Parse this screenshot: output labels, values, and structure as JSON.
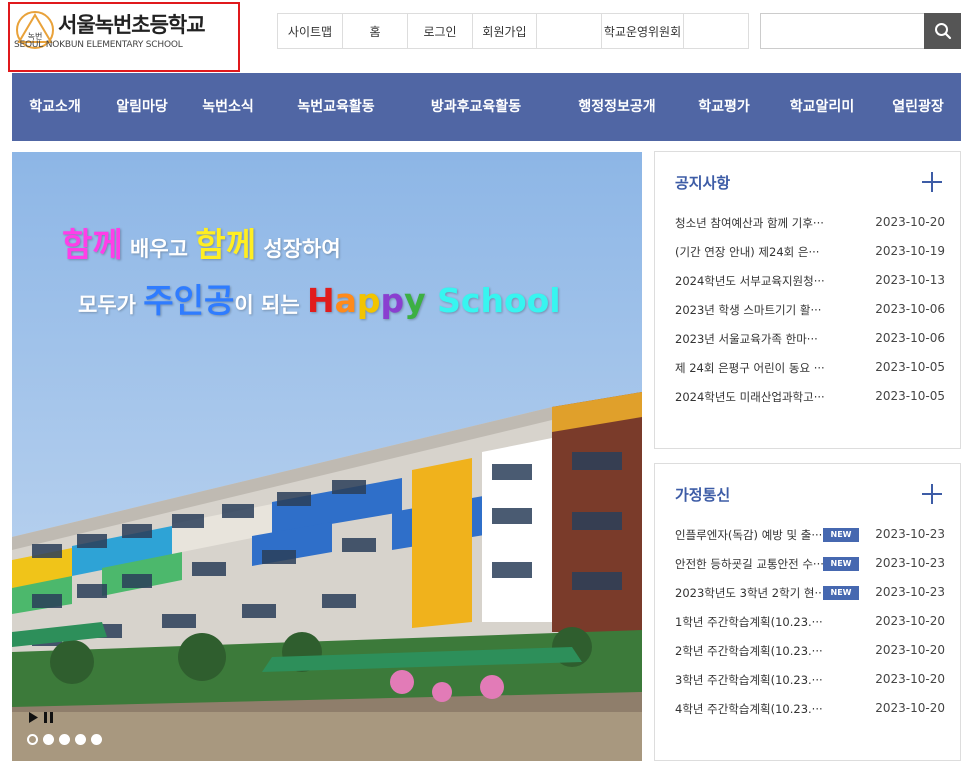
{
  "logo": {
    "name": "서울녹번초등학교",
    "emblem_text": "녹번",
    "english": "SEOUL NOKBUN ELEMENTARY SCHOOL"
  },
  "util_nav": [
    {
      "label": "사이트맵"
    },
    {
      "label": "홈"
    },
    {
      "label": "로그인"
    },
    {
      "label": "회원가입"
    },
    {
      "label": ""
    },
    {
      "label": "학교운영위원회"
    },
    {
      "label": ""
    }
  ],
  "search": {
    "placeholder": "",
    "icon": "search-icon"
  },
  "gnb": [
    {
      "label": "학교소개"
    },
    {
      "label": "알림마당"
    },
    {
      "label": "녹번소식"
    },
    {
      "label": "녹번교육활동"
    },
    {
      "label": "방과후교육활동"
    },
    {
      "label": "행정정보공개"
    },
    {
      "label": "학교평가"
    },
    {
      "label": "학교알리미"
    },
    {
      "label": "열린광장"
    }
  ],
  "visual": {
    "line1": [
      {
        "text": "함께",
        "color": "#ff3ee8",
        "size": "big"
      },
      {
        "text": " 배우고 ",
        "color": "#ffffff",
        "size": "small"
      },
      {
        "text": "함께",
        "color": "#ffee22",
        "size": "big"
      },
      {
        "text": " 성장하여",
        "color": "#ffffff",
        "size": "small"
      }
    ],
    "line2": [
      {
        "text": "모두가 ",
        "color": "#ffffff",
        "size": "small"
      },
      {
        "text": "주인공",
        "color": "#2f7cff",
        "size": "big"
      },
      {
        "text": "이 ",
        "color": "#ffffff",
        "size": "small"
      },
      {
        "text": "되는 ",
        "color": "#ffffff",
        "size": "small"
      },
      {
        "text": "H",
        "color": "#e11c1c",
        "size": "big"
      },
      {
        "text": "a",
        "color": "#ff8a1a",
        "size": "big"
      },
      {
        "text": "p",
        "color": "#f2c400",
        "size": "big"
      },
      {
        "text": "p",
        "color": "#8a3fd0",
        "size": "big"
      },
      {
        "text": "y",
        "color": "#3cb043",
        "size": "big"
      },
      {
        "text": " School",
        "color": "#37f5f0",
        "size": "big"
      }
    ],
    "slides": 5,
    "active_slide": 0
  },
  "notice": {
    "title": "공지사항",
    "posts": [
      {
        "title": "청소년 참여예산과 함께 기후···",
        "date": "2023-10-20"
      },
      {
        "title": "(기간 연장 안내) 제24회 은···",
        "date": "2023-10-19"
      },
      {
        "title": "2024학년도 서부교육지원청···",
        "date": "2023-10-13"
      },
      {
        "title": "2023년 학생 스마트기기 활···",
        "date": "2023-10-06"
      },
      {
        "title": "2023년 서울교육가족 한마···",
        "date": "2023-10-06"
      },
      {
        "title": "제 24회 은평구 어린이 동요 ···",
        "date": "2023-10-05"
      },
      {
        "title": "2024학년도 미래산업과학고···",
        "date": "2023-10-05"
      }
    ]
  },
  "home_letters": {
    "title": "가정통신",
    "posts": [
      {
        "title": "인플루엔자(독감) 예방 및 출···",
        "date": "2023-10-23",
        "badge": "NEW"
      },
      {
        "title": "안전한 등하굣길 교통안전 수···",
        "date": "2023-10-23",
        "badge": "NEW"
      },
      {
        "title": "2023학년도 3학년 2학기 현···",
        "date": "2023-10-23",
        "badge": "NEW"
      },
      {
        "title": "1학년 주간학습계획(10.23.···",
        "date": "2023-10-20",
        "badge": ""
      },
      {
        "title": "2학년 주간학습계획(10.23.···",
        "date": "2023-10-20",
        "badge": ""
      },
      {
        "title": "3학년 주간학습계획(10.23.···",
        "date": "2023-10-20",
        "badge": ""
      },
      {
        "title": "4학년 주간학습계획(10.23.···",
        "date": "2023-10-20",
        "badge": ""
      }
    ]
  }
}
